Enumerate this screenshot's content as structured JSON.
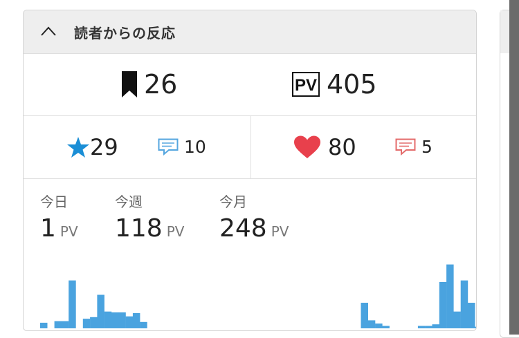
{
  "panel": {
    "title": "読者からの反応",
    "collapse_icon": "chevron-up-icon"
  },
  "totals": {
    "bookmarks": {
      "icon": "bookmark-icon",
      "value": "26"
    },
    "pageviews": {
      "icon": "pv-icon",
      "icon_text": "PV",
      "value": "405"
    }
  },
  "reactions": {
    "stars": {
      "icon": "star-icon",
      "value": "29",
      "color": "#1a8ed6"
    },
    "comments_left": {
      "icon": "comment-icon",
      "value": "10",
      "color": "#55a6df"
    },
    "hearts": {
      "icon": "heart-icon",
      "value": "80",
      "color": "#e8404c"
    },
    "comments_right": {
      "icon": "comment-icon",
      "value": "5",
      "color": "#e46b6b"
    }
  },
  "stats": {
    "today": {
      "label": "今日",
      "value": "1",
      "unit": "PV"
    },
    "week": {
      "label": "今週",
      "value": "118",
      "unit": "PV"
    },
    "month": {
      "label": "今月",
      "value": "248",
      "unit": "PV"
    }
  },
  "chart_data": {
    "type": "bar",
    "color": "#4aa3df",
    "values": [
      7,
      0,
      9,
      9,
      60,
      0,
      12,
      14,
      42,
      21,
      20,
      20,
      15,
      19,
      8,
      0,
      0,
      0,
      0,
      0,
      0,
      0,
      0,
      0,
      0,
      0,
      0,
      0,
      0,
      0,
      0,
      0,
      0,
      0,
      0,
      0,
      0,
      0,
      0,
      0,
      0,
      0,
      0,
      0,
      0,
      32,
      10,
      6,
      3,
      0,
      0,
      0,
      0,
      3,
      3,
      5,
      58,
      80,
      21,
      60,
      32,
      2
    ],
    "ylim": [
      0,
      90
    ]
  },
  "colors": {
    "accent": "#4aa3df",
    "header_bg": "#eeeeee"
  }
}
